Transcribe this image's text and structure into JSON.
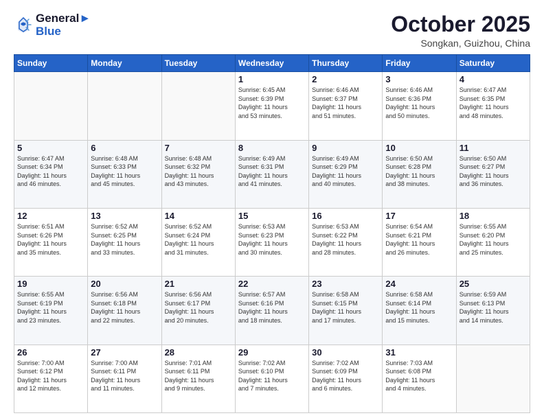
{
  "logo": {
    "line1": "General",
    "line2": "Blue"
  },
  "header": {
    "month": "October 2025",
    "location": "Songkan, Guizhou, China"
  },
  "weekdays": [
    "Sunday",
    "Monday",
    "Tuesday",
    "Wednesday",
    "Thursday",
    "Friday",
    "Saturday"
  ],
  "weeks": [
    [
      {
        "day": "",
        "info": ""
      },
      {
        "day": "",
        "info": ""
      },
      {
        "day": "",
        "info": ""
      },
      {
        "day": "1",
        "info": "Sunrise: 6:45 AM\nSunset: 6:39 PM\nDaylight: 11 hours\nand 53 minutes."
      },
      {
        "day": "2",
        "info": "Sunrise: 6:46 AM\nSunset: 6:37 PM\nDaylight: 11 hours\nand 51 minutes."
      },
      {
        "day": "3",
        "info": "Sunrise: 6:46 AM\nSunset: 6:36 PM\nDaylight: 11 hours\nand 50 minutes."
      },
      {
        "day": "4",
        "info": "Sunrise: 6:47 AM\nSunset: 6:35 PM\nDaylight: 11 hours\nand 48 minutes."
      }
    ],
    [
      {
        "day": "5",
        "info": "Sunrise: 6:47 AM\nSunset: 6:34 PM\nDaylight: 11 hours\nand 46 minutes."
      },
      {
        "day": "6",
        "info": "Sunrise: 6:48 AM\nSunset: 6:33 PM\nDaylight: 11 hours\nand 45 minutes."
      },
      {
        "day": "7",
        "info": "Sunrise: 6:48 AM\nSunset: 6:32 PM\nDaylight: 11 hours\nand 43 minutes."
      },
      {
        "day": "8",
        "info": "Sunrise: 6:49 AM\nSunset: 6:31 PM\nDaylight: 11 hours\nand 41 minutes."
      },
      {
        "day": "9",
        "info": "Sunrise: 6:49 AM\nSunset: 6:29 PM\nDaylight: 11 hours\nand 40 minutes."
      },
      {
        "day": "10",
        "info": "Sunrise: 6:50 AM\nSunset: 6:28 PM\nDaylight: 11 hours\nand 38 minutes."
      },
      {
        "day": "11",
        "info": "Sunrise: 6:50 AM\nSunset: 6:27 PM\nDaylight: 11 hours\nand 36 minutes."
      }
    ],
    [
      {
        "day": "12",
        "info": "Sunrise: 6:51 AM\nSunset: 6:26 PM\nDaylight: 11 hours\nand 35 minutes."
      },
      {
        "day": "13",
        "info": "Sunrise: 6:52 AM\nSunset: 6:25 PM\nDaylight: 11 hours\nand 33 minutes."
      },
      {
        "day": "14",
        "info": "Sunrise: 6:52 AM\nSunset: 6:24 PM\nDaylight: 11 hours\nand 31 minutes."
      },
      {
        "day": "15",
        "info": "Sunrise: 6:53 AM\nSunset: 6:23 PM\nDaylight: 11 hours\nand 30 minutes."
      },
      {
        "day": "16",
        "info": "Sunrise: 6:53 AM\nSunset: 6:22 PM\nDaylight: 11 hours\nand 28 minutes."
      },
      {
        "day": "17",
        "info": "Sunrise: 6:54 AM\nSunset: 6:21 PM\nDaylight: 11 hours\nand 26 minutes."
      },
      {
        "day": "18",
        "info": "Sunrise: 6:55 AM\nSunset: 6:20 PM\nDaylight: 11 hours\nand 25 minutes."
      }
    ],
    [
      {
        "day": "19",
        "info": "Sunrise: 6:55 AM\nSunset: 6:19 PM\nDaylight: 11 hours\nand 23 minutes."
      },
      {
        "day": "20",
        "info": "Sunrise: 6:56 AM\nSunset: 6:18 PM\nDaylight: 11 hours\nand 22 minutes."
      },
      {
        "day": "21",
        "info": "Sunrise: 6:56 AM\nSunset: 6:17 PM\nDaylight: 11 hours\nand 20 minutes."
      },
      {
        "day": "22",
        "info": "Sunrise: 6:57 AM\nSunset: 6:16 PM\nDaylight: 11 hours\nand 18 minutes."
      },
      {
        "day": "23",
        "info": "Sunrise: 6:58 AM\nSunset: 6:15 PM\nDaylight: 11 hours\nand 17 minutes."
      },
      {
        "day": "24",
        "info": "Sunrise: 6:58 AM\nSunset: 6:14 PM\nDaylight: 11 hours\nand 15 minutes."
      },
      {
        "day": "25",
        "info": "Sunrise: 6:59 AM\nSunset: 6:13 PM\nDaylight: 11 hours\nand 14 minutes."
      }
    ],
    [
      {
        "day": "26",
        "info": "Sunrise: 7:00 AM\nSunset: 6:12 PM\nDaylight: 11 hours\nand 12 minutes."
      },
      {
        "day": "27",
        "info": "Sunrise: 7:00 AM\nSunset: 6:11 PM\nDaylight: 11 hours\nand 11 minutes."
      },
      {
        "day": "28",
        "info": "Sunrise: 7:01 AM\nSunset: 6:11 PM\nDaylight: 11 hours\nand 9 minutes."
      },
      {
        "day": "29",
        "info": "Sunrise: 7:02 AM\nSunset: 6:10 PM\nDaylight: 11 hours\nand 7 minutes."
      },
      {
        "day": "30",
        "info": "Sunrise: 7:02 AM\nSunset: 6:09 PM\nDaylight: 11 hours\nand 6 minutes."
      },
      {
        "day": "31",
        "info": "Sunrise: 7:03 AM\nSunset: 6:08 PM\nDaylight: 11 hours\nand 4 minutes."
      },
      {
        "day": "",
        "info": ""
      }
    ]
  ]
}
